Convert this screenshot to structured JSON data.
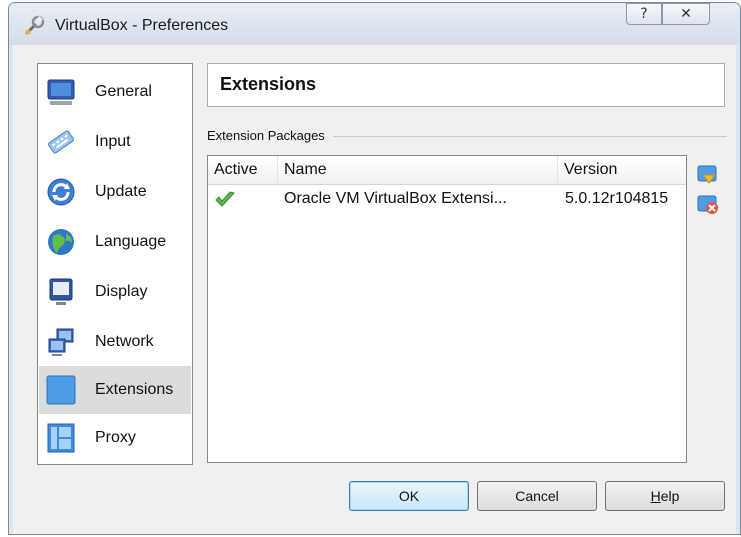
{
  "window": {
    "title": "VirtualBox - Preferences"
  },
  "titlebar_buttons": {
    "help": "?",
    "close": "✕"
  },
  "nav": {
    "items": [
      {
        "label": "General",
        "icon": "monitor-icon"
      },
      {
        "label": "Input",
        "icon": "keyboard-icon"
      },
      {
        "label": "Update",
        "icon": "refresh-icon"
      },
      {
        "label": "Language",
        "icon": "globe-icon"
      },
      {
        "label": "Display",
        "icon": "display-icon"
      },
      {
        "label": "Network",
        "icon": "network-icon"
      },
      {
        "label": "Extensions",
        "icon": "extension-icon",
        "selected": true
      },
      {
        "label": "Proxy",
        "icon": "proxy-icon"
      }
    ]
  },
  "page": {
    "title": "Extensions",
    "group_label": "Extension Packages"
  },
  "table": {
    "columns": [
      "Active",
      "Name",
      "Version"
    ],
    "rows": [
      {
        "active": true,
        "name": "Oracle VM VirtualBox Extensi...",
        "version": "5.0.12r104815"
      }
    ]
  },
  "tools": [
    "add-package-icon",
    "remove-package-icon"
  ],
  "buttons": {
    "ok": "OK",
    "cancel": "Cancel",
    "help_first": "H",
    "help_rest": "elp"
  },
  "colors": {
    "accent": "#3c7fb1",
    "selection": "#dcdcdc",
    "check": "#4caf50"
  }
}
